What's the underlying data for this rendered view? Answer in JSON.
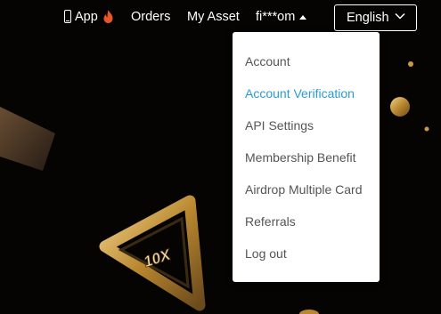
{
  "nav": {
    "app_label": "App",
    "orders_label": "Orders",
    "my_asset_label": "My Asset",
    "user_label": "fi***om",
    "language_label": "English"
  },
  "icons": {
    "app": "mobile-phone-icon",
    "hot": "fire-icon",
    "user_menu": "caret-up-icon",
    "language": "chevron-down-icon"
  },
  "account_menu": {
    "items": [
      {
        "label": "Account",
        "active": false
      },
      {
        "label": "Account Verification",
        "active": true
      },
      {
        "label": "API Settings",
        "active": false
      },
      {
        "label": "Membership Benefit",
        "active": false
      },
      {
        "label": "Airdrop Multiple Card",
        "active": false
      },
      {
        "label": "Referrals",
        "active": false
      },
      {
        "label": "Log out",
        "active": false
      }
    ]
  },
  "banner": {
    "multiplier_text": "10X"
  },
  "colors": {
    "background": "#050403",
    "active_link": "#2b9bd6",
    "menu_text": "#555555",
    "gold": "#c99a45",
    "fire": "#e8552a"
  }
}
